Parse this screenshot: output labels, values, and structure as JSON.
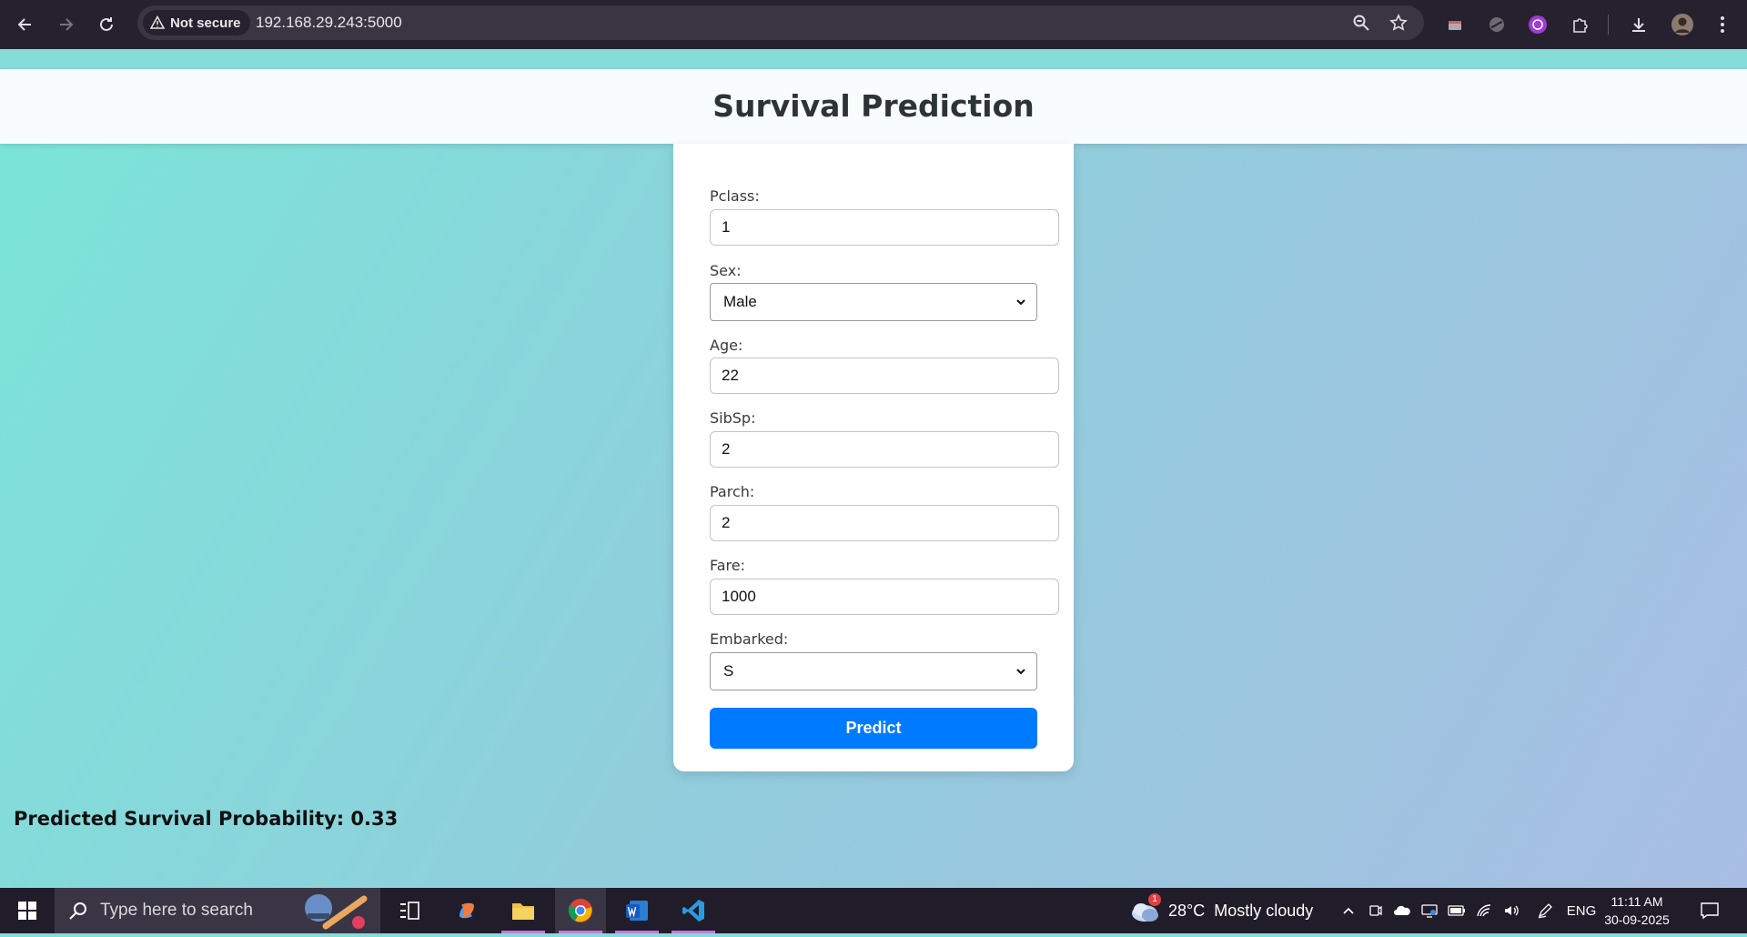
{
  "browser": {
    "security_label": "Not secure",
    "url": "192.168.29.243:5000"
  },
  "page": {
    "title": "Survival Prediction",
    "fields": [
      {
        "label": "Pclass:",
        "value": "1"
      },
      {
        "label": "Sex:",
        "value": "Male"
      },
      {
        "label": "Age:",
        "value": "22"
      },
      {
        "label": "SibSp:",
        "value": "2"
      },
      {
        "label": "Parch:",
        "value": "2"
      },
      {
        "label": "Fare:",
        "value": "1000"
      },
      {
        "label": "Embarked:",
        "value": "S"
      }
    ],
    "predict_label": "Predict",
    "result_text": "Predicted Survival Probability: 0.33"
  },
  "taskbar": {
    "search_placeholder": "Type here to search",
    "weather_temp": "28°C",
    "weather_desc": "Mostly cloudy",
    "weather_badge": "1",
    "language": "ENG",
    "time": "11:11 AM",
    "date": "30-09-2025"
  },
  "colors": {
    "accent": "#007bff",
    "page_gradient_start": "#7ae6d8",
    "page_gradient_end": "#a8bde3"
  }
}
